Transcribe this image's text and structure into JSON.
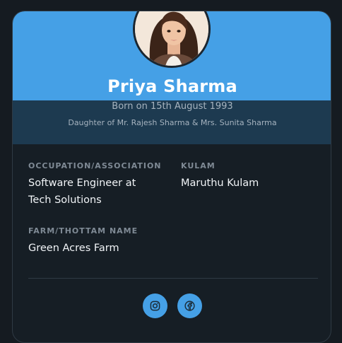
{
  "profile": {
    "name": "Priya Sharma",
    "born": "Born on 15th August 1993",
    "parents": "Daughter of Mr. Rajesh Sharma & Mrs. Sunita Sharma",
    "avatar_icon": "woman-portrait-avatar"
  },
  "details": {
    "occupation_label": "OCCUPATION/ASSOCIATION",
    "occupation_line1": "Software Engineer at",
    "occupation_line2": "Tech Solutions",
    "kulam_label": "KULAM",
    "kulam_value": "Maruthu Kulam",
    "farm_label": "FARM/THOTTAM NAME",
    "farm_value": "Green Acres Farm"
  },
  "social": [
    {
      "name": "instagram",
      "icon": "instagram-icon"
    },
    {
      "name": "facebook",
      "icon": "facebook-icon"
    }
  ],
  "colors": {
    "accent": "#45a0e6",
    "background": "#151b21",
    "card": "#161e25",
    "subband": "#1d3a50",
    "label": "#7f8a95",
    "text": "#f1f4f7"
  }
}
